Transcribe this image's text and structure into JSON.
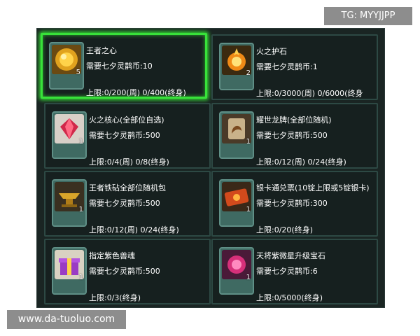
{
  "watermark_top": "TG: MYYJJPP",
  "watermark_bottom": "www.da-tuoluo.com",
  "colors": {
    "panel": "#1a2523",
    "card_border": "#2d4944",
    "selected_border": "#38e23a",
    "text": "#ffffff"
  },
  "items": [
    {
      "name": "王者之心",
      "cost": "需要七夕灵鹊币:10",
      "limit": "上限:0/200(周) 0/400(终身)",
      "qty": "5",
      "icon": "gold-orb-icon",
      "selected": true
    },
    {
      "name": "火之护石",
      "cost": "需要七夕灵鹊币:1",
      "limit": "上限:0/3000(周) 0/6000(终身",
      "qty": "2",
      "icon": "fire-stone-icon",
      "selected": false
    },
    {
      "name": "火之核心(全部位自选)",
      "cost": "需要七夕灵鹊币:500",
      "limit": "上限:0/4(周) 0/8(终身)",
      "qty": "1",
      "icon": "red-gem-icon",
      "selected": false
    },
    {
      "name": "耀世龙牌(全部位随机)",
      "cost": "需要七夕灵鹊币:500",
      "limit": "上限:0/12(周) 0/24(终身)",
      "qty": "1",
      "icon": "dragon-card-icon",
      "selected": false
    },
    {
      "name": "王者铁砧全部位随机包",
      "cost": "需要七夕灵鹊币:500",
      "limit": "上限:0/12(周) 0/24(终身)",
      "qty": "1",
      "icon": "anvil-icon",
      "selected": false
    },
    {
      "name": "银卡通兑票(10锭上限或5锭银卡)",
      "cost": "需要七夕灵鹊币:300",
      "limit": "上限:0/20(终身)",
      "qty": "1",
      "icon": "ticket-icon",
      "selected": false
    },
    {
      "name": "指定紫色兽魂",
      "cost": "需要七夕灵鹊币:500",
      "limit": "上限:0/3(终身)",
      "qty": "1",
      "icon": "gift-box-icon",
      "selected": false
    },
    {
      "name": "天将紫微星升级宝石",
      "cost": "需要七夕灵鹊币:6",
      "limit": "上限:0/5000(终身)",
      "qty": "1",
      "icon": "purple-gem-icon",
      "selected": false
    }
  ]
}
